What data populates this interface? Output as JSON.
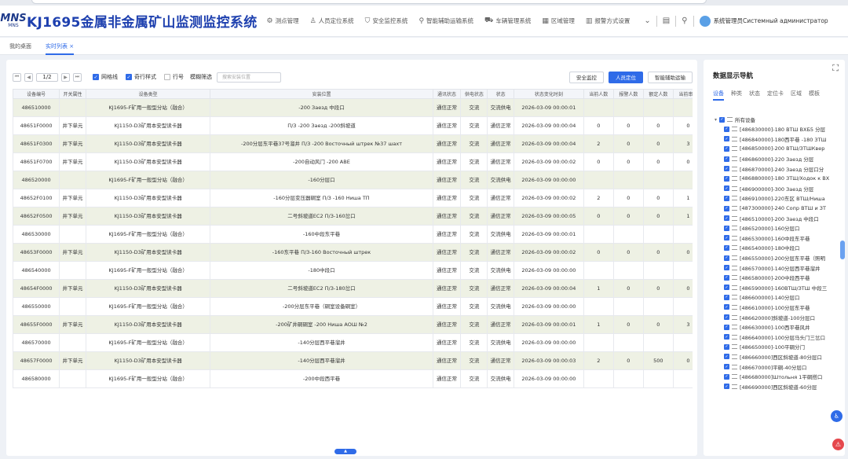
{
  "header": {
    "logo_big": "MNS",
    "logo_small": "MNS",
    "title": "KJ1695金属非金属矿山监测监控系统",
    "nav": [
      {
        "icon": "gear-icon",
        "glyph": "⚙",
        "label": "测点管理"
      },
      {
        "icon": "person-icon",
        "glyph": "♙",
        "label": "人员定位系统"
      },
      {
        "icon": "shield-icon",
        "glyph": "⛉",
        "label": "安全监控系统"
      },
      {
        "icon": "pin-icon",
        "glyph": "⚲",
        "label": "智能辅助运输系统"
      },
      {
        "icon": "car-icon",
        "glyph": "⛟",
        "label": "车辆管理系统"
      },
      {
        "icon": "grid-icon",
        "glyph": "▦",
        "label": "区域管理"
      },
      {
        "icon": "chart-icon",
        "glyph": "▥",
        "label": "报警方式设置"
      }
    ],
    "more_glyph": "⌄",
    "doc_glyph": "▤",
    "search_glyph": "⚲",
    "user": "系统管理员Системный администратор"
  },
  "tabs": [
    {
      "label": "我的桌面",
      "active": false
    },
    {
      "label": "实时列表 ×",
      "active": true
    }
  ],
  "toolbar": {
    "first": "⏮",
    "prev": "◀",
    "page": "1/2",
    "next": "▶",
    "last": "⏭",
    "checks": [
      {
        "label": "网格线",
        "checked": true
      },
      {
        "label": "奇行样式",
        "checked": true
      },
      {
        "label": "行号",
        "checked": false
      }
    ],
    "filter_label": "模糊筛选",
    "filter_placeholder": "搜索安装位置",
    "buttons": [
      {
        "label": "安全监控",
        "primary": false
      },
      {
        "label": "人员定位",
        "primary": true
      },
      {
        "label": "智能辅助运输",
        "primary": false
      }
    ]
  },
  "table": {
    "columns": [
      "设备编号",
      "开关属性",
      "设备类型",
      "安装位置",
      "通讯状态",
      "供电状态",
      "状态",
      "状态变化时刻",
      "当前人数",
      "报警人数",
      "额定人数",
      "当前串数"
    ],
    "rows": [
      [
        "486510000",
        "",
        "KJ1695-F矿用一般型分站（融合）",
        "-200 Заезд 中段口",
        "通信正常",
        "交流",
        "交流供电",
        "2026-03-09 00:00:01",
        "",
        "",
        "",
        ""
      ],
      [
        "48651F0000",
        "井下单元",
        "KJ1150-D3矿用本安型读卡器",
        "П/З -200 Заезд -200斜坡道",
        "通信正常",
        "交流",
        "通信正常",
        "2026-03-09 00:00:04",
        "0",
        "0",
        "0",
        "0"
      ],
      [
        "48651F0300",
        "井下单元",
        "KJ1150-D3矿用本安型读卡器",
        "-200分层东平巷37号溜井 П/З -200 Восточный штрек №37 шахт",
        "通信正常",
        "交流",
        "通信正常",
        "2026-03-09 00:00:04",
        "2",
        "0",
        "0",
        "3"
      ],
      [
        "48651F0700",
        "井下单元",
        "KJ1150-D3矿用本安型读卡器",
        "-200自动风门 -200 АВЕ",
        "通信正常",
        "交流",
        "通信正常",
        "2026-03-09 00:00:02",
        "0",
        "0",
        "0",
        "0"
      ],
      [
        "486520000",
        "",
        "KJ1695-F矿用一般型分站（融合）",
        "-160分层口",
        "通信正常",
        "交流",
        "交流供电",
        "2026-03-09 00:00:00",
        "",
        "",
        "",
        ""
      ],
      [
        "48652F0100",
        "井下单元",
        "KJ1150-D3矿用本安型读卡器",
        "-160分层变压器硐室 П/З -160 Ниша ТП",
        "通信正常",
        "交流",
        "通信正常",
        "2026-03-09 00:00:02",
        "2",
        "0",
        "0",
        "1"
      ],
      [
        "48652F0500",
        "井下单元",
        "KJ1150-D3矿用本安型读卡器",
        "二号斜坡道EC2 П/З-160岔口",
        "通信正常",
        "交流",
        "通信正常",
        "2026-03-09 00:00:05",
        "0",
        "0",
        "0",
        "1"
      ],
      [
        "486530000",
        "",
        "KJ1695-F矿用一般型分站（融合）",
        "-160中段东平巷",
        "通信正常",
        "交流",
        "交流供电",
        "2026-03-09 00:00:01",
        "",
        "",
        "",
        ""
      ],
      [
        "48653F0000",
        "井下单元",
        "KJ1150-D3矿用本安型读卡器",
        "-160东平巷 П/З-160 Восточный штрек",
        "通信正常",
        "交流",
        "通信正常",
        "2026-03-09 00:00:02",
        "0",
        "0",
        "0",
        "0"
      ],
      [
        "486540000",
        "",
        "KJ1695-F矿用一般型分站（融合）",
        "-180中段口",
        "通信正常",
        "交流",
        "交流供电",
        "2026-03-09 00:00:00",
        "",
        "",
        "",
        ""
      ],
      [
        "48654F0000",
        "井下单元",
        "KJ1150-D3矿用本安型读卡器",
        "二号斜坡道EC2 П/З-180岔口",
        "通信正常",
        "交流",
        "通信正常",
        "2026-03-09 00:00:04",
        "1",
        "0",
        "0",
        "0"
      ],
      [
        "486550000",
        "",
        "KJ1695-F矿用一般型分站（融合）",
        "-200分层东平巷（硐室设备硐室）",
        "通信正常",
        "交流",
        "交流供电",
        "2026-03-09 00:00:00",
        "",
        "",
        "",
        ""
      ],
      [
        "48655F0000",
        "井下单元",
        "KJ1150-D3矿用本安型读卡器",
        "-200矿井硐硐室 -200 Ниша АОШ №2",
        "通信正常",
        "交流",
        "通信正常",
        "2026-03-09 00:00:01",
        "1",
        "0",
        "0",
        "3"
      ],
      [
        "486570000",
        "",
        "KJ1695-F矿用一般型分站（融合）",
        "-140分层西平巷溜井",
        "通信正常",
        "交流",
        "交流供电",
        "2026-03-09 00:00:00",
        "",
        "",
        "",
        ""
      ],
      [
        "48657F0000",
        "井下单元",
        "KJ1150-D3矿用本安型读卡器",
        "-140分层西平巷溜井",
        "通信正常",
        "交流",
        "通信正常",
        "2026-03-09 00:00:03",
        "2",
        "0",
        "500",
        "0"
      ],
      [
        "486580000",
        "",
        "KJ1695-F矿用一般型分站（融合）",
        "-200中段西平巷",
        "通信正常",
        "交流",
        "交流供电",
        "2026-03-09 00:00:00",
        "",
        "",
        "",
        ""
      ]
    ]
  },
  "scroll_indicator": "▲",
  "sidebar": {
    "expand_glyph": "⛶",
    "title": "数据显示导航",
    "tabs": [
      {
        "label": "设备",
        "active": true
      },
      {
        "label": "种类",
        "active": false
      },
      {
        "label": "状态",
        "active": false
      },
      {
        "label": "定位卡",
        "active": false
      },
      {
        "label": "区域",
        "active": false
      },
      {
        "label": "模板",
        "active": false
      }
    ],
    "root": "所有设备",
    "items": [
      "[486830000]-180 ВТШ ВХБ5 分层",
      "[486840000]-180西平巷 -180 ЗТШ",
      "[486850000]-200 ВТШ/ЗТШКвер",
      "[486860000]-220 Заезд 分层",
      "[486870000]-240 Заезд 分层口分",
      "[486880000]-180 ЗТШ/Ходок к ВХ",
      "[486900000]-300 Заезд 分层",
      "[486910000]-220东区 ВТШ/Ниша",
      "[487300000]-240 Сопр ВТШ и ЗТ",
      "[486510000]-200 Заезд 中段口",
      "[486520000]-160分层口",
      "[486530000]-160中段东平巷",
      "[486540000]-180中段口",
      "[486550000]-200分层东平巷（照明",
      "[486570000]-140分层西平巷溜井",
      "[486580000]-200中段西平巷",
      "[486590000]-160ВТШ/ЗТШ 中段三",
      "[486600000]-140分层口",
      "[486610000]-100分层东平巷",
      "[486620000]斜坡道-100分层口",
      "[486630000]-100西平巷风井",
      "[486640000]-100分层马头门三岔口",
      "[486650000]-100平硐分门",
      "[486660000]西区斜坡道-80分层口",
      "[486670000]平硐-40分层口",
      "[486680000]Штольня 1平硐搭口",
      "[486690000]西区斜坡道-60分层"
    ]
  }
}
